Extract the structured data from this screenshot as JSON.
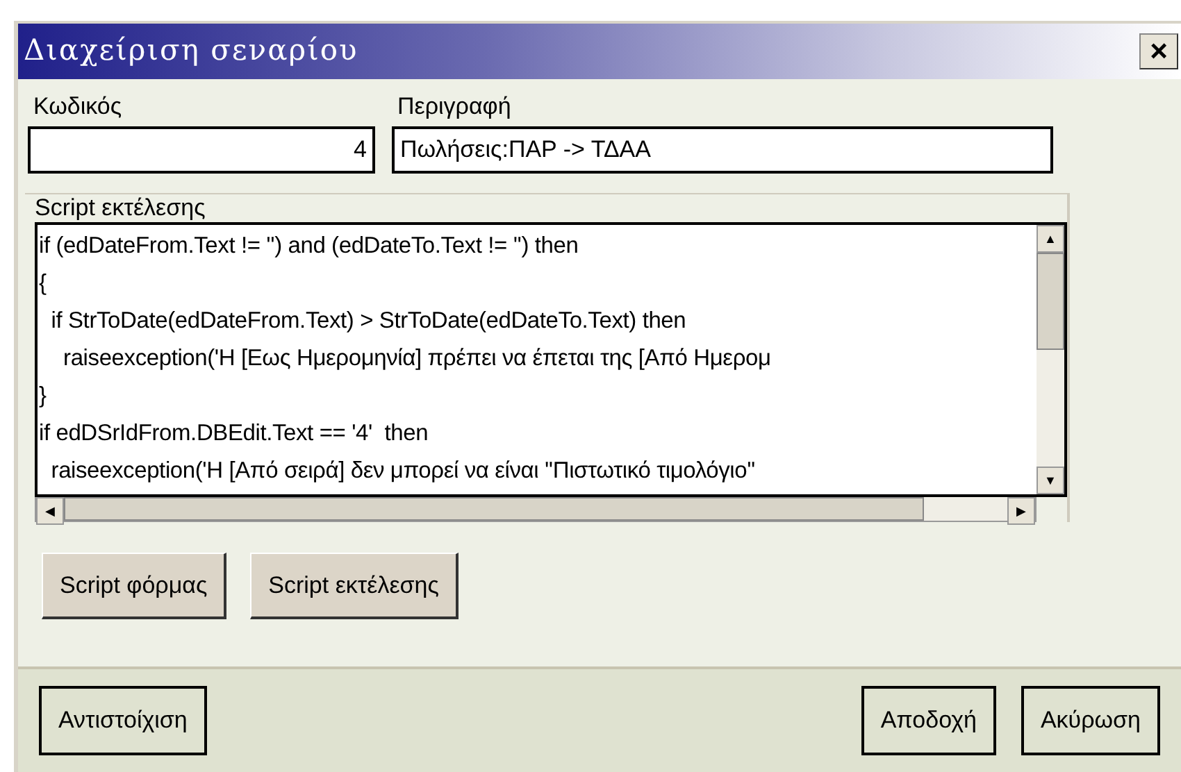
{
  "window": {
    "title": "Διαχείριση σεναρίου",
    "close": "×"
  },
  "fields": [
    {
      "label": "Κωδικός",
      "value": "4"
    },
    {
      "label": "Περιγραφή",
      "value": "Πωλήσεις:ΠΑΡ -> ΤΔΑΑ"
    }
  ],
  "script_group": {
    "label": "Script εκτέλεσης",
    "lines": [
      "if (edDateFrom.Text != '') and (edDateTo.Text != '') then",
      "{",
      "  if StrToDate(edDateFrom.Text) > StrToDate(edDateTo.Text) then",
      "    raiseexception('Η [Εως Ημερομηνία] πρέπει να έπεται της [Από Ημερομ",
      "}",
      "if edDSrIdFrom.DBEdit.Text == '4'  then",
      "  raiseexception('Η [Από σειρά] δεν μπορεί να είναι ''Πιστωτικό τιμολόγιο''"
    ],
    "up_arrow": "▲",
    "down_arrow": "▼",
    "left_arrow": "◀",
    "right_arrow": "▶"
  },
  "script_buttons": [
    "Script φόρμας",
    "Script εκτέλεσης"
  ],
  "footer_buttons": [
    "Αντιστοίχιση",
    "Αποδοχή",
    "Ακύρωση"
  ]
}
